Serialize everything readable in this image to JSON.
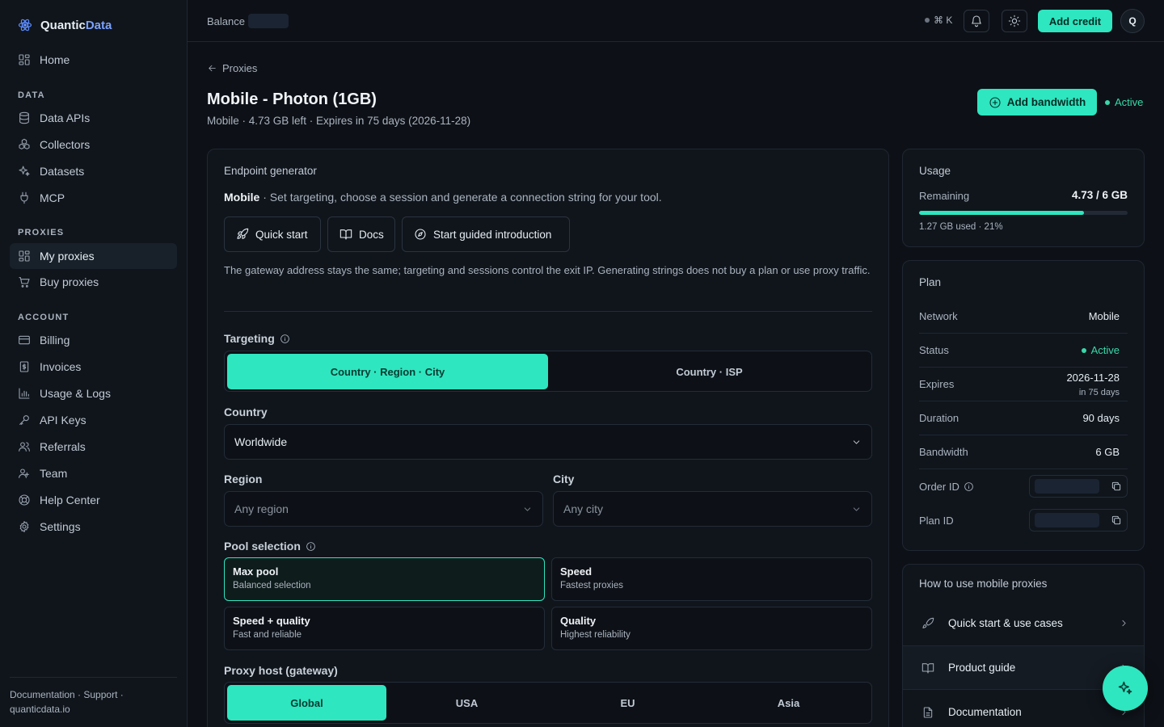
{
  "brand": {
    "name_a": "Quantic",
    "name_b": "Data"
  },
  "nav": {
    "home": "Home",
    "section_data": "DATA",
    "data_apis": "Data APIs",
    "collectors": "Collectors",
    "datasets": "Datasets",
    "mcp": "MCP",
    "section_proxies": "PROXIES",
    "my_proxies": "My proxies",
    "buy_proxies": "Buy proxies",
    "section_account": "ACCOUNT",
    "billing": "Billing",
    "invoices": "Invoices",
    "usage_logs": "Usage & Logs",
    "api_keys": "API Keys",
    "referrals": "Referrals",
    "team": "Team",
    "help_center": "Help Center",
    "settings": "Settings"
  },
  "footer": {
    "line1": "Documentation · Support ·",
    "line2": "quanticdata.io"
  },
  "topbar": {
    "balance_label": "Balance",
    "shortcut": "⌘ K",
    "add_credit": "Add credit",
    "avatar_initial": "Q"
  },
  "header": {
    "breadcrumb": "Proxies",
    "title": "Mobile - Photon (1GB)",
    "subtitle": "Mobile · 4.73 GB left · Expires in 75 days (2026-11-28)",
    "add_bandwidth": "Add bandwidth",
    "status": "Active"
  },
  "endpoint": {
    "title": "Endpoint generator",
    "desc_bold": "Mobile",
    "desc_rest": " · Set targeting, choose a session and generate a connection string for your tool.",
    "btn_quick_start": "Quick start",
    "btn_docs": "Docs",
    "btn_guided": "Start guided introduction",
    "note": "The gateway address stays the same; targeting and sessions control the exit IP. Generating strings does not buy a plan or use proxy traffic.",
    "targeting_label": "Targeting",
    "targeting_options": [
      "Country · Region · City",
      "Country · ISP"
    ],
    "country_label": "Country",
    "country_value": "Worldwide",
    "region_label": "Region",
    "region_placeholder": "Any region",
    "city_label": "City",
    "city_placeholder": "Any city",
    "pool_label": "Pool selection",
    "pools": [
      {
        "title": "Max pool",
        "sub": "Balanced selection"
      },
      {
        "title": "Speed",
        "sub": "Fastest proxies"
      },
      {
        "title": "Speed + quality",
        "sub": "Fast and reliable"
      },
      {
        "title": "Quality",
        "sub": "Highest reliability"
      }
    ],
    "host_label": "Proxy host (gateway)",
    "hosts": [
      "Global",
      "USA",
      "EU",
      "Asia"
    ]
  },
  "usage": {
    "title": "Usage",
    "remaining_label": "Remaining",
    "remaining_value": "4.73 / 6 GB",
    "used_fraction": 0.79,
    "used_text": "1.27 GB used · 21%"
  },
  "plan": {
    "title": "Plan",
    "network_label": "Network",
    "network_value": "Mobile",
    "status_label": "Status",
    "status_value": "Active",
    "expires_label": "Expires",
    "expires_value": "2026-11-28",
    "expires_sub": "in 75 days",
    "duration_label": "Duration",
    "duration_value": "90 days",
    "bandwidth_label": "Bandwidth",
    "bandwidth_value": "6 GB",
    "order_id_label": "Order ID",
    "plan_id_label": "Plan ID"
  },
  "howto": {
    "title": "How to use mobile proxies",
    "items": [
      "Quick start & use cases",
      "Product guide",
      "Documentation"
    ]
  },
  "colors": {
    "accent": "#2ee6c0",
    "active": "#38d9a9",
    "bg": "#0d1117"
  }
}
